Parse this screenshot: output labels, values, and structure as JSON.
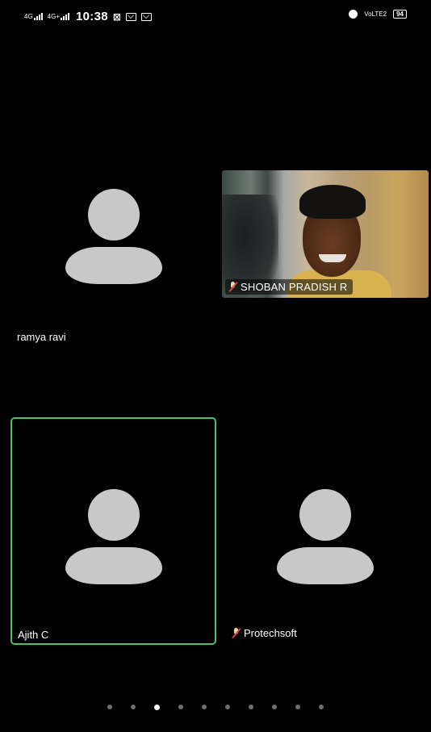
{
  "status_bar": {
    "net1": "4G",
    "net2": "4G+",
    "time": "10:38",
    "volte": "VoLTE2",
    "battery": "94"
  },
  "participants": [
    {
      "name": "ramya ravi",
      "video": false,
      "muted": false
    },
    {
      "name": "SHOBAN PRADISH R",
      "video": true,
      "muted": true
    },
    {
      "name": "Ajith C",
      "video": false,
      "muted": false,
      "active_speaker": true
    },
    {
      "name": "Protechsoft",
      "video": false,
      "muted": true
    }
  ],
  "pager": {
    "total": 10,
    "current_index": 2
  },
  "colors": {
    "active_border": "#4cbf6b",
    "avatar": "#c8c8c8",
    "background": "#000000"
  }
}
